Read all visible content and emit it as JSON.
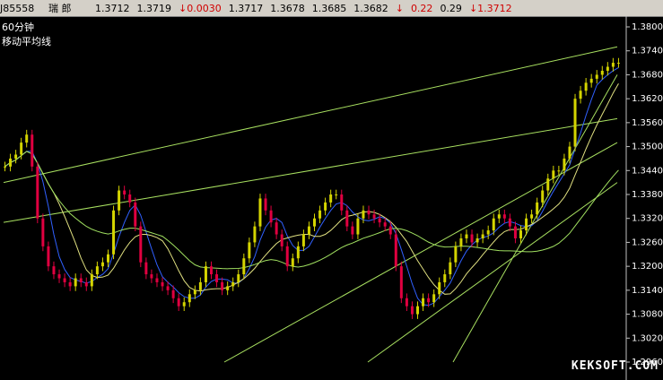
{
  "quote_bar": {
    "code": "J85558",
    "name": "瑞 郎",
    "values": [
      "1.3712",
      "1.3719"
    ],
    "change": "↓0.0030",
    "values2": [
      "1.3717",
      "1.3678",
      "1.3685",
      "1.3682"
    ],
    "arrow": "↓",
    "pct": "0.22",
    "vol": "0.29",
    "last": "↓1.3712"
  },
  "chart_panel": {
    "period_label": "60分钟",
    "indicator_label": "移动平均线"
  },
  "watermark": "KEKSOFT.COM",
  "colors": {
    "background": "#000000",
    "candle_up": "#d4d400",
    "candle_down": "#e00040",
    "trend_line": "#a8e060",
    "ma_blue": "#3060ff",
    "ma_yellow": "#e0e080",
    "ma_green": "#a0e060"
  },
  "chart_data": {
    "type": "candlestick",
    "ylim": [
      1.296,
      1.38
    ],
    "y_ticks": [
      "1.3800",
      "1.3740",
      "1.3680",
      "1.3620",
      "1.3560",
      "1.3500",
      "1.3440",
      "1.3380",
      "1.3320",
      "1.3260",
      "1.3200",
      "1.3140",
      "1.3080",
      "1.3020",
      "1.2960"
    ],
    "series": [
      {
        "name": "close",
        "values": [
          1.345,
          1.347,
          1.348,
          1.351,
          1.353,
          1.345,
          1.332,
          1.325,
          1.32,
          1.318,
          1.317,
          1.316,
          1.315,
          1.317,
          1.316,
          1.315,
          1.318,
          1.32,
          1.321,
          1.323,
          1.334,
          1.339,
          1.338,
          1.336,
          1.33,
          1.321,
          1.318,
          1.317,
          1.316,
          1.315,
          1.314,
          1.312,
          1.31,
          1.311,
          1.313,
          1.314,
          1.316,
          1.32,
          1.318,
          1.316,
          1.314,
          1.315,
          1.316,
          1.318,
          1.322,
          1.326,
          1.33,
          1.337,
          1.334,
          1.331,
          1.328,
          1.325,
          1.32,
          1.322,
          1.325,
          1.328,
          1.33,
          1.332,
          1.334,
          1.336,
          1.338,
          1.338,
          1.334,
          1.33,
          1.328,
          1.332,
          1.334,
          1.333,
          1.332,
          1.331,
          1.33,
          1.328,
          1.32,
          1.312,
          1.31,
          1.308,
          1.31,
          1.312,
          1.311,
          1.313,
          1.316,
          1.318,
          1.321,
          1.325,
          1.327,
          1.328,
          1.326,
          1.327,
          1.328,
          1.329,
          1.332,
          1.333,
          1.332,
          1.33,
          1.327,
          1.329,
          1.332,
          1.333,
          1.336,
          1.339,
          1.342,
          1.344,
          1.344,
          1.347,
          1.35,
          1.362,
          1.364,
          1.366,
          1.367,
          1.368,
          1.369,
          1.37,
          1.371,
          1.371
        ]
      }
    ]
  }
}
